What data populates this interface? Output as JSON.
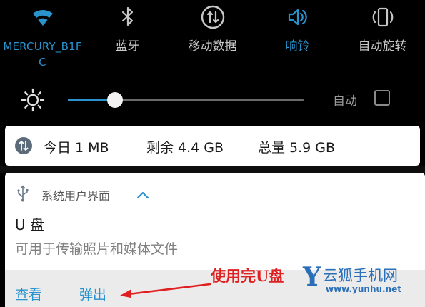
{
  "quick_settings": {
    "tiles": [
      {
        "label": "MERCURY_B1FC",
        "icon": "wifi-icon",
        "active": true
      },
      {
        "label": "蓝牙",
        "icon": "bluetooth-icon",
        "active": false
      },
      {
        "label": "移动数据",
        "icon": "mobile-data-icon",
        "active": false
      },
      {
        "label": "响铃",
        "icon": "volume-icon",
        "active": true
      },
      {
        "label": "自动旋转",
        "icon": "rotate-icon",
        "active": false
      }
    ]
  },
  "brightness": {
    "level": 0.2,
    "auto_label": "自动",
    "auto_checked": false
  },
  "data_usage": {
    "today": "今日 1 MB",
    "remaining": "剩余 4.4 GB",
    "total": "总量 5.9 GB"
  },
  "usb_notification": {
    "app_name": "系统用户界面",
    "title": "U 盘",
    "body": "可用于传输照片和媒体文件",
    "actions": {
      "view": "查看",
      "eject": "弹出"
    }
  },
  "annotation": {
    "text": "使用完U盘"
  },
  "watermark": {
    "logo": "Y",
    "name": "云狐手机网",
    "url": "www.yunhu.net"
  },
  "colors": {
    "accent": "#2a93ce",
    "background": "#000000",
    "card": "#ffffff",
    "annotation": "#e02020",
    "watermark": "#2a6fb8"
  }
}
